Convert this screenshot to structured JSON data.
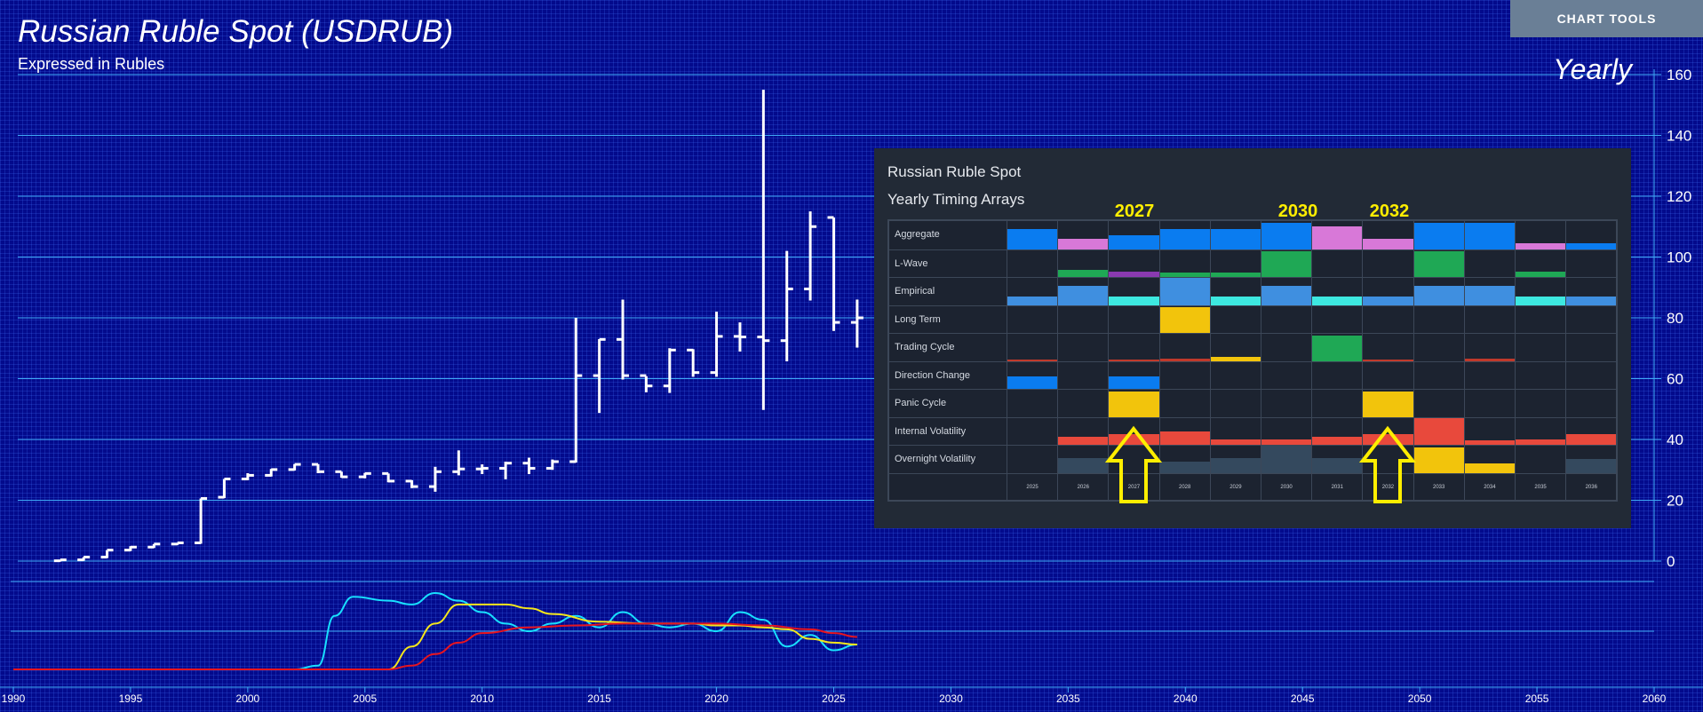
{
  "header": {
    "title": "Russian Ruble Spot (USDRUB)",
    "subtitle": "Expressed in Rubles",
    "period": "Yearly",
    "chart_tools_label": "CHART TOOLS"
  },
  "colors": {
    "background": "#030a8c",
    "gridline": "#3fa9f5",
    "price_bar": "#ffffff",
    "cyan_line": "#18e0ff",
    "yellow_line": "#f5e61b",
    "red_line": "#e8141e",
    "highlight": "#ffee00"
  },
  "chart_data": {
    "type": "ohlc",
    "x_ticks": [
      1990,
      1995,
      2000,
      2005,
      2010,
      2015,
      2020,
      2025,
      2030,
      2035,
      2040,
      2045,
      2050,
      2055,
      2060
    ],
    "xlim": [
      1990,
      2060
    ],
    "y_ticks": [
      0,
      20,
      40,
      60,
      80,
      100,
      120,
      140,
      160
    ],
    "ylim": [
      0,
      160
    ],
    "bars": [
      {
        "x": 1992,
        "open": 0.1,
        "high": 0.4,
        "low": 0.1,
        "close": 0.4
      },
      {
        "x": 1993,
        "open": 0.4,
        "high": 1.3,
        "low": 0.4,
        "close": 1.3
      },
      {
        "x": 1994,
        "open": 1.3,
        "high": 3.6,
        "low": 1.3,
        "close": 3.6
      },
      {
        "x": 1995,
        "open": 3.6,
        "high": 4.9,
        "low": 3.6,
        "close": 4.6
      },
      {
        "x": 1996,
        "open": 4.6,
        "high": 5.6,
        "low": 4.6,
        "close": 5.6
      },
      {
        "x": 1997,
        "open": 5.6,
        "high": 6.0,
        "low": 5.6,
        "close": 6.0
      },
      {
        "x": 1998,
        "open": 6.0,
        "high": 20.6,
        "low": 6.0,
        "close": 20.6
      },
      {
        "x": 1999,
        "open": 21.0,
        "high": 27.0,
        "low": 21.0,
        "close": 27.0
      },
      {
        "x": 2000,
        "open": 27.0,
        "high": 28.9,
        "low": 26.9,
        "close": 28.2
      },
      {
        "x": 2001,
        "open": 28.2,
        "high": 30.3,
        "low": 28.1,
        "close": 30.1
      },
      {
        "x": 2002,
        "open": 30.1,
        "high": 31.9,
        "low": 30.1,
        "close": 31.8
      },
      {
        "x": 2003,
        "open": 31.8,
        "high": 31.9,
        "low": 29.2,
        "close": 29.4
      },
      {
        "x": 2004,
        "open": 29.4,
        "high": 29.4,
        "low": 27.7,
        "close": 27.7
      },
      {
        "x": 2005,
        "open": 27.7,
        "high": 29.0,
        "low": 27.5,
        "close": 28.8
      },
      {
        "x": 2006,
        "open": 28.8,
        "high": 28.8,
        "low": 26.2,
        "close": 26.3
      },
      {
        "x": 2007,
        "open": 26.3,
        "high": 26.6,
        "low": 24.3,
        "close": 24.5
      },
      {
        "x": 2008,
        "open": 24.5,
        "high": 31.0,
        "low": 23.1,
        "close": 29.4
      },
      {
        "x": 2009,
        "open": 29.4,
        "high": 36.4,
        "low": 28.5,
        "close": 30.3
      },
      {
        "x": 2010,
        "open": 30.3,
        "high": 31.8,
        "low": 28.9,
        "close": 30.5
      },
      {
        "x": 2011,
        "open": 30.5,
        "high": 32.7,
        "low": 27.2,
        "close": 32.2
      },
      {
        "x": 2012,
        "open": 32.2,
        "high": 34.0,
        "low": 28.9,
        "close": 30.5
      },
      {
        "x": 2013,
        "open": 30.5,
        "high": 33.4,
        "low": 30.3,
        "close": 32.7
      },
      {
        "x": 2014,
        "open": 32.7,
        "high": 80.0,
        "low": 32.7,
        "close": 61.0
      },
      {
        "x": 2015,
        "open": 61.0,
        "high": 73.0,
        "low": 49.0,
        "close": 72.9
      },
      {
        "x": 2016,
        "open": 72.9,
        "high": 86.0,
        "low": 60.0,
        "close": 61.0
      },
      {
        "x": 2017,
        "open": 61.0,
        "high": 60.8,
        "low": 55.8,
        "close": 57.6
      },
      {
        "x": 2018,
        "open": 57.6,
        "high": 70.0,
        "low": 55.6,
        "close": 69.4
      },
      {
        "x": 2019,
        "open": 69.4,
        "high": 69.7,
        "low": 60.9,
        "close": 62.0
      },
      {
        "x": 2020,
        "open": 62.0,
        "high": 82.0,
        "low": 60.9,
        "close": 73.9
      },
      {
        "x": 2021,
        "open": 73.9,
        "high": 78.5,
        "low": 69.2,
        "close": 73.7
      },
      {
        "x": 2022,
        "open": 73.7,
        "high": 155.0,
        "low": 50.0,
        "close": 72.5
      },
      {
        "x": 2023,
        "open": 72.5,
        "high": 102.0,
        "low": 66.0,
        "close": 89.5
      },
      {
        "x": 2024,
        "open": 89.5,
        "high": 115.0,
        "low": 86.0,
        "close": 110.0
      },
      {
        "x": 2025,
        "open": 113.0,
        "high": 113.0,
        "low": 76.0,
        "close": 78.5
      },
      {
        "x": 2026,
        "open": 78.5,
        "high": 86.0,
        "low": 70.5,
        "close": 80.0
      }
    ],
    "indicator_lines": [
      {
        "color": "#18e0ff",
        "points": [
          [
            1990,
            -1
          ],
          [
            2002,
            -1
          ],
          [
            2003,
            -0.9
          ],
          [
            2003.7,
            0.4
          ],
          [
            2004.5,
            0.9
          ],
          [
            2006,
            0.8
          ],
          [
            2007,
            0.7
          ],
          [
            2008,
            1.0
          ],
          [
            2009,
            0.8
          ],
          [
            2010,
            0.5
          ],
          [
            2011,
            0.2
          ],
          [
            2012,
            0.0
          ],
          [
            2013,
            0.2
          ],
          [
            2014,
            0.4
          ],
          [
            2015,
            0.1
          ],
          [
            2016,
            0.5
          ],
          [
            2017,
            0.2
          ],
          [
            2018,
            0.1
          ],
          [
            2019,
            0.2
          ],
          [
            2020,
            0.0
          ],
          [
            2021,
            0.5
          ],
          [
            2022,
            0.3
          ],
          [
            2023,
            -0.4
          ],
          [
            2024,
            -0.1
          ],
          [
            2025,
            -0.5
          ],
          [
            2026,
            -0.35
          ]
        ]
      },
      {
        "color": "#f5e61b",
        "points": [
          [
            1990,
            -1
          ],
          [
            2006,
            -1
          ],
          [
            2007,
            -0.4
          ],
          [
            2008,
            0.2
          ],
          [
            2009,
            0.7
          ],
          [
            2011,
            0.7
          ],
          [
            2012,
            0.6
          ],
          [
            2013,
            0.45
          ],
          [
            2015,
            0.25
          ],
          [
            2017,
            0.2
          ],
          [
            2019,
            0.2
          ],
          [
            2020,
            0.15
          ],
          [
            2021,
            0.15
          ],
          [
            2022,
            0.1
          ],
          [
            2023,
            0.05
          ],
          [
            2024,
            -0.2
          ],
          [
            2025,
            -0.3
          ],
          [
            2026,
            -0.35
          ]
        ]
      },
      {
        "color": "#e8141e",
        "points": [
          [
            1990,
            -1
          ],
          [
            2006,
            -1
          ],
          [
            2007,
            -0.9
          ],
          [
            2008,
            -0.6
          ],
          [
            2009,
            -0.3
          ],
          [
            2010,
            -0.05
          ],
          [
            2012,
            0.1
          ],
          [
            2014,
            0.15
          ],
          [
            2016,
            0.2
          ],
          [
            2018,
            0.2
          ],
          [
            2020,
            0.2
          ],
          [
            2022,
            0.15
          ],
          [
            2024,
            0.05
          ],
          [
            2025,
            -0.05
          ],
          [
            2026,
            -0.15
          ]
        ]
      }
    ]
  },
  "panel": {
    "title": "Russian Ruble Spot",
    "subtitle": "Yearly Timing Arrays",
    "highlight_years": [
      "2027",
      "2030",
      "2032"
    ],
    "year_labels": [
      "2025",
      "2026",
      "2027",
      "2028",
      "2029",
      "2030",
      "2031",
      "2032",
      "2033",
      "2034",
      "2035",
      "2036"
    ],
    "rows": [
      {
        "label": "Aggregate",
        "bars": [
          {
            "c": 0,
            "h": 0.7,
            "color": "#0a7cf0"
          },
          {
            "c": 1,
            "h": 0.35,
            "color": "#d878d8"
          },
          {
            "c": 2,
            "h": 0.5,
            "color": "#0a7cf0"
          },
          {
            "c": 3,
            "h": 0.7,
            "color": "#0a7cf0"
          },
          {
            "c": 4,
            "h": 0.7,
            "color": "#0a7cf0"
          },
          {
            "c": 5,
            "h": 0.95,
            "color": "#0a7cf0"
          },
          {
            "c": 6,
            "h": 0.8,
            "color": "#d878d8"
          },
          {
            "c": 7,
            "h": 0.35,
            "color": "#d878d8"
          },
          {
            "c": 8,
            "h": 0.95,
            "color": "#0a7cf0"
          },
          {
            "c": 9,
            "h": 0.95,
            "color": "#0a7cf0"
          },
          {
            "c": 10,
            "h": 0.2,
            "color": "#d878d8"
          },
          {
            "c": 11,
            "h": 0.2,
            "color": "#0a7cf0"
          }
        ]
      },
      {
        "label": "L-Wave",
        "bars": [
          {
            "c": 1,
            "h": 0.25,
            "color": "#1fa855"
          },
          {
            "c": 2,
            "h": 0.2,
            "color": "#8a3ab0"
          },
          {
            "c": 3,
            "h": 0.15,
            "color": "#1fa855"
          },
          {
            "c": 4,
            "h": 0.15,
            "color": "#1fa855"
          },
          {
            "c": 5,
            "h": 0.95,
            "color": "#1fa855"
          },
          {
            "c": 8,
            "h": 0.95,
            "color": "#1fa855"
          },
          {
            "c": 10,
            "h": 0.2,
            "color": "#1fa855"
          }
        ]
      },
      {
        "label": "Empirical",
        "bars": [
          {
            "c": 0,
            "h": 0.3,
            "color": "#3f8fe0"
          },
          {
            "c": 1,
            "h": 0.7,
            "color": "#3f8fe0"
          },
          {
            "c": 2,
            "h": 0.3,
            "color": "#3de8e0"
          },
          {
            "c": 3,
            "h": 1.0,
            "color": "#3f8fe0"
          },
          {
            "c": 4,
            "h": 0.3,
            "color": "#3de8e0"
          },
          {
            "c": 5,
            "h": 0.7,
            "color": "#3f8fe0"
          },
          {
            "c": 6,
            "h": 0.3,
            "color": "#3de8e0"
          },
          {
            "c": 7,
            "h": 0.3,
            "color": "#3f8fe0"
          },
          {
            "c": 8,
            "h": 0.7,
            "color": "#3f8fe0"
          },
          {
            "c": 9,
            "h": 0.7,
            "color": "#3f8fe0"
          },
          {
            "c": 10,
            "h": 0.3,
            "color": "#3de8e0"
          },
          {
            "c": 11,
            "h": 0.3,
            "color": "#3f8fe0"
          }
        ]
      },
      {
        "label": "Long Term",
        "bars": [
          {
            "c": 3,
            "h": 0.95,
            "color": "#f2c40c"
          }
        ]
      },
      {
        "label": "Trading Cycle",
        "bars": [
          {
            "c": 0,
            "h": 0.05,
            "color": "#c0392b"
          },
          {
            "c": 2,
            "h": 0.05,
            "color": "#c0392b"
          },
          {
            "c": 3,
            "h": 0.08,
            "color": "#c0392b"
          },
          {
            "c": 4,
            "h": 0.15,
            "color": "#f2c40c"
          },
          {
            "c": 6,
            "h": 0.95,
            "color": "#1fa855"
          },
          {
            "c": 7,
            "h": 0.05,
            "color": "#c0392b"
          },
          {
            "c": 9,
            "h": 0.08,
            "color": "#c0392b"
          }
        ]
      },
      {
        "label": "Direction Change",
        "bars": [
          {
            "c": 0,
            "h": 0.45,
            "color": "#0a7cf0"
          },
          {
            "c": 2,
            "h": 0.45,
            "color": "#0a7cf0"
          }
        ]
      },
      {
        "label": "Panic Cycle",
        "bars": [
          {
            "c": 2,
            "h": 0.95,
            "color": "#f2c40c"
          },
          {
            "c": 7,
            "h": 0.95,
            "color": "#f2c40c"
          }
        ]
      },
      {
        "label": "Internal Volatility",
        "bars": [
          {
            "c": 1,
            "h": 0.3,
            "color": "#e8493c"
          },
          {
            "c": 2,
            "h": 0.4,
            "color": "#e8493c"
          },
          {
            "c": 3,
            "h": 0.5,
            "color": "#e8493c"
          },
          {
            "c": 4,
            "h": 0.2,
            "color": "#e8493c"
          },
          {
            "c": 5,
            "h": 0.2,
            "color": "#e8493c"
          },
          {
            "c": 6,
            "h": 0.3,
            "color": "#e8493c"
          },
          {
            "c": 7,
            "h": 0.4,
            "color": "#e8493c"
          },
          {
            "c": 8,
            "h": 1.0,
            "color": "#e8493c"
          },
          {
            "c": 9,
            "h": 0.15,
            "color": "#e8493c"
          },
          {
            "c": 10,
            "h": 0.2,
            "color": "#e8493c"
          },
          {
            "c": 11,
            "h": 0.4,
            "color": "#e8493c"
          }
        ]
      },
      {
        "label": "Overnight Volatility",
        "bars": [
          {
            "c": 1,
            "h": 0.55,
            "color": "#34495e"
          },
          {
            "c": 3,
            "h": 0.4,
            "color": "#34495e"
          },
          {
            "c": 4,
            "h": 0.55,
            "color": "#34495e"
          },
          {
            "c": 5,
            "h": 1.0,
            "color": "#34495e"
          },
          {
            "c": 6,
            "h": 0.55,
            "color": "#34495e"
          },
          {
            "c": 8,
            "h": 0.95,
            "color": "#f2c40c"
          },
          {
            "c": 9,
            "h": 0.35,
            "color": "#f2c40c"
          },
          {
            "c": 11,
            "h": 0.5,
            "color": "#34495e"
          }
        ]
      }
    ],
    "arrow_cells": [
      2,
      7
    ]
  }
}
